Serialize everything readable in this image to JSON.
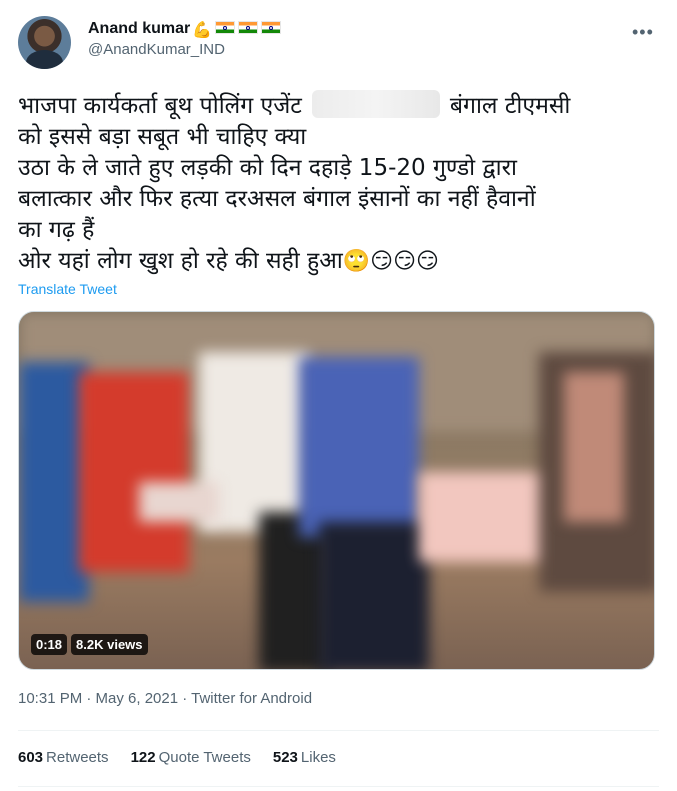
{
  "author": {
    "display_name": "Anand kumar",
    "handle": "@AnandKumar_IND",
    "badge_emoji": "💪"
  },
  "tweet": {
    "lines": [
      "भाजपा कार्यकर्ता बूथ पोलिंग एजेंट",
      "बंगाल टीएमसी",
      "को इससे बड़ा सबूत भी चाहिए क्या",
      "उठा के ले जाते हुए लड़की को दिन दहाड़े 15-20 गुण्डो द्वारा",
      "बलात्कार और फिर हत्या दरअसल बंगाल इंसानों का नहीं हैवानों",
      "का गढ़ हैं",
      "ओर यहां लोग खुश हो रहे की सही हुआ"
    ],
    "emojis": [
      "🙄",
      "😏",
      "😏",
      "😏"
    ],
    "translate_label": "Translate Tweet"
  },
  "video": {
    "duration": "0:18",
    "views": "8.2K views"
  },
  "meta": {
    "timestamp": "10:31 PM · May 6, 2021 · Twitter for Android"
  },
  "stats": {
    "retweets_count": "603",
    "retweets_label": "Retweets",
    "quote_count": "122",
    "quote_label": "Quote Tweets",
    "likes_count": "523",
    "likes_label": "Likes"
  },
  "colors": {
    "link": "#1d9bf0",
    "secondary_text": "#536471",
    "primary_text": "#0f1419"
  }
}
